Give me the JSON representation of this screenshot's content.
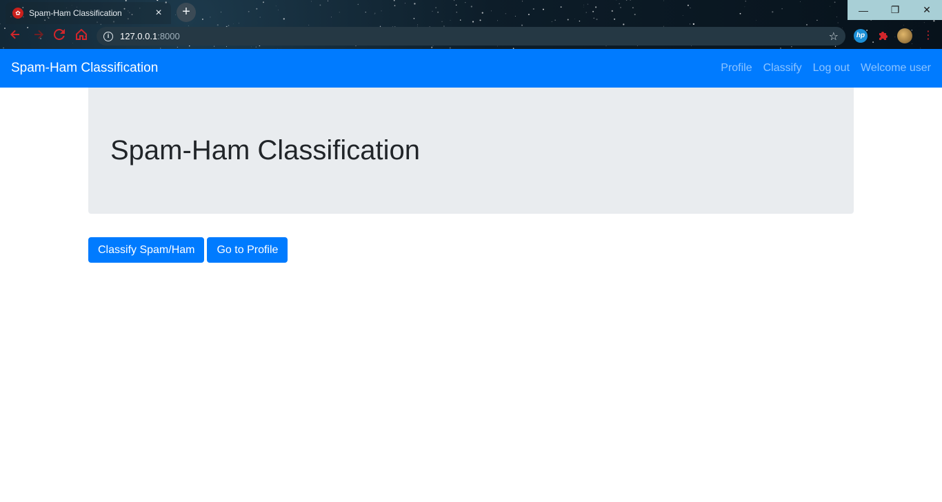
{
  "browser": {
    "tab_title": "Spam-Ham Classification",
    "tab_close": "×",
    "new_tab": "+",
    "url_host": "127.0.0.1",
    "url_port": ":8000",
    "window_min": "—",
    "window_max": "❐",
    "window_close": "✕",
    "ext_hp": "hp"
  },
  "navbar": {
    "brand": "Spam-Ham Classification",
    "links": [
      "Profile",
      "Classify",
      "Log out",
      "Welcome user"
    ]
  },
  "jumbotron": {
    "title": "Spam-Ham Classification"
  },
  "actions": {
    "classify_label": "Classify Spam/Ham",
    "profile_label": "Go to Profile"
  },
  "colors": {
    "primary": "#007bff",
    "jumbotron_bg": "#e9ecef",
    "heading": "#212529"
  }
}
